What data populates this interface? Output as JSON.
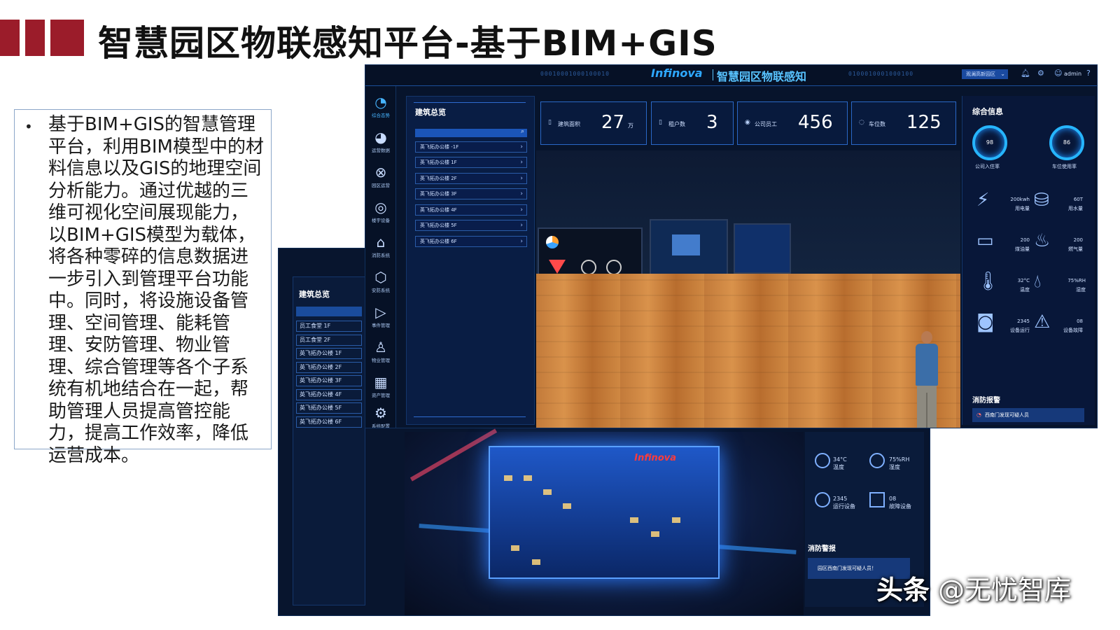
{
  "slide": {
    "title": "智慧园区物联感知平台-基于BIM+GIS",
    "bullet": "•",
    "body": "基于BIM+GIS的智慧管理平台，利用BIM模型中的材料信息以及GIS的地理空间分析能力。通过优越的三维可视化空间展现能力，以BIM+GIS模型为载体，将各种零碎的信息数据进一步引入到管理平台功能中。同时，将设施设备管理、空间管理、能耗管理、安防管理、物业管理、综合管理等各个子系统有机地结合在一起，帮助管理人员提高管控能力，提高工作效率，降低运营成本。",
    "brand_color": "#9b1c2a"
  },
  "dashboard": {
    "brand": "Infinova",
    "title": "智慧园区物联感知",
    "binary_left": "00010001000100010",
    "binary_right": "0100010001000100",
    "park_select": "观澜高新园区",
    "user": "admin",
    "nav": [
      {
        "icon": "◔",
        "label": "综合态势"
      },
      {
        "icon": "◕",
        "label": "运营数据"
      },
      {
        "icon": "⊗",
        "label": "园区运营"
      },
      {
        "icon": "◎",
        "label": "楼宇设备"
      },
      {
        "icon": "⌂",
        "label": "消防系统"
      },
      {
        "icon": "⬡",
        "label": "安防系统"
      },
      {
        "icon": "▷",
        "label": "事件管理"
      },
      {
        "icon": "♙",
        "label": "物业管理"
      },
      {
        "icon": "▦",
        "label": "资产管理"
      },
      {
        "icon": "⚙",
        "label": "系统配置"
      }
    ],
    "building_panel": {
      "title": "建筑总览",
      "rows": [
        "英飞拓办公楼 -1F",
        "英飞拓办公楼 1F",
        "英飞拓办公楼 2F",
        "英飞拓办公楼 3F",
        "英飞拓办公楼 4F",
        "英飞拓办公楼 5F",
        "英飞拓办公楼 6F"
      ]
    },
    "stats": [
      {
        "label": "建筑面积",
        "value": "27",
        "unit": "万"
      },
      {
        "label": "租户数",
        "value": "3",
        "unit": ""
      },
      {
        "label": "公司员工",
        "value": "456",
        "unit": ""
      },
      {
        "label": "车位数",
        "value": "125",
        "unit": ""
      }
    ],
    "info_panel": {
      "title": "综合信息",
      "gauges": [
        {
          "value": "98",
          "label": "公司入住率"
        },
        {
          "value": "86",
          "label": "车位使用率"
        }
      ],
      "metrics": [
        {
          "value": "200kwh",
          "label": "用电量"
        },
        {
          "value": "60T",
          "label": "用水量"
        },
        {
          "value": "200",
          "label": "煤油量"
        },
        {
          "value": "200",
          "label": "燃气量"
        },
        {
          "value": "32°C",
          "label": "温度"
        },
        {
          "value": "75%RH",
          "label": "湿度"
        },
        {
          "value": "2345",
          "label": "设备运行"
        },
        {
          "value": "08",
          "label": "设备故障"
        }
      ],
      "alarm_title": "消防报警",
      "alarm_text": "西南门发现可疑人员"
    }
  },
  "back_screen": {
    "panel_title": "建筑总览",
    "rows": [
      "员工食堂 1F",
      "员工食堂 2F",
      "英飞拓办公楼 1F",
      "英飞拓办公楼 2F",
      "英飞拓办公楼 3F",
      "英飞拓办公楼 4F",
      "英飞拓办公楼 5F",
      "英飞拓办公楼 6F"
    ],
    "building_logo": "Infinova",
    "metrics": [
      {
        "value": "34°C",
        "label": "温度"
      },
      {
        "value": "75%RH",
        "label": "湿度"
      },
      {
        "value": "2345",
        "label": "运行设备"
      },
      {
        "value": "08",
        "label": "故障设备"
      }
    ],
    "alarm_title": "消防警报",
    "alarm_text": "园区西南门发现可疑人员！"
  },
  "watermark": {
    "part1": "头条",
    "part2": " @无忧智库"
  }
}
